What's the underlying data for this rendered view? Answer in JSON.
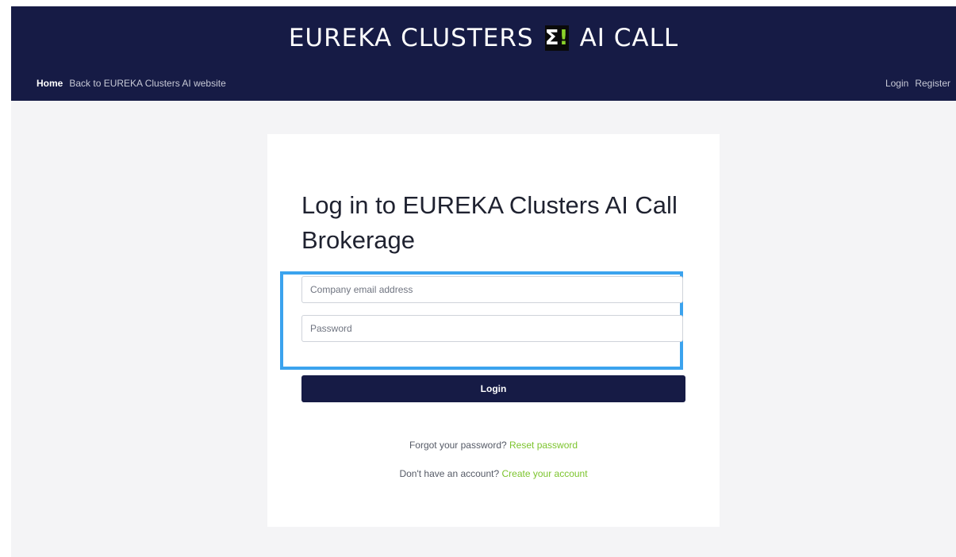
{
  "header": {
    "brand_left": "EUREKA CLUSTERS",
    "logo_sigma": "Σ",
    "logo_bang": "!",
    "brand_right": "AI CALL",
    "nav_left": [
      {
        "label": "Home"
      },
      {
        "label": "Back to EUREKA Clusters AI website"
      }
    ],
    "nav_right": [
      {
        "label": "Login"
      },
      {
        "label": "Register"
      }
    ]
  },
  "login_card": {
    "title": "Log in to EUREKA Clusters AI Call Brokerage",
    "email": {
      "placeholder": "Company email address",
      "value": ""
    },
    "password": {
      "placeholder": "Password",
      "value": ""
    },
    "submit_label": "Login",
    "forgot": {
      "text": "Forgot your password?",
      "link": "Reset password"
    },
    "signup": {
      "text": "Don't have an account?",
      "link": "Create your account"
    }
  },
  "colors": {
    "header_bg": "#161b45",
    "accent_link": "#7cc42d",
    "highlight_border": "#3ba3ee",
    "logo_bang": "#8bd32a"
  }
}
